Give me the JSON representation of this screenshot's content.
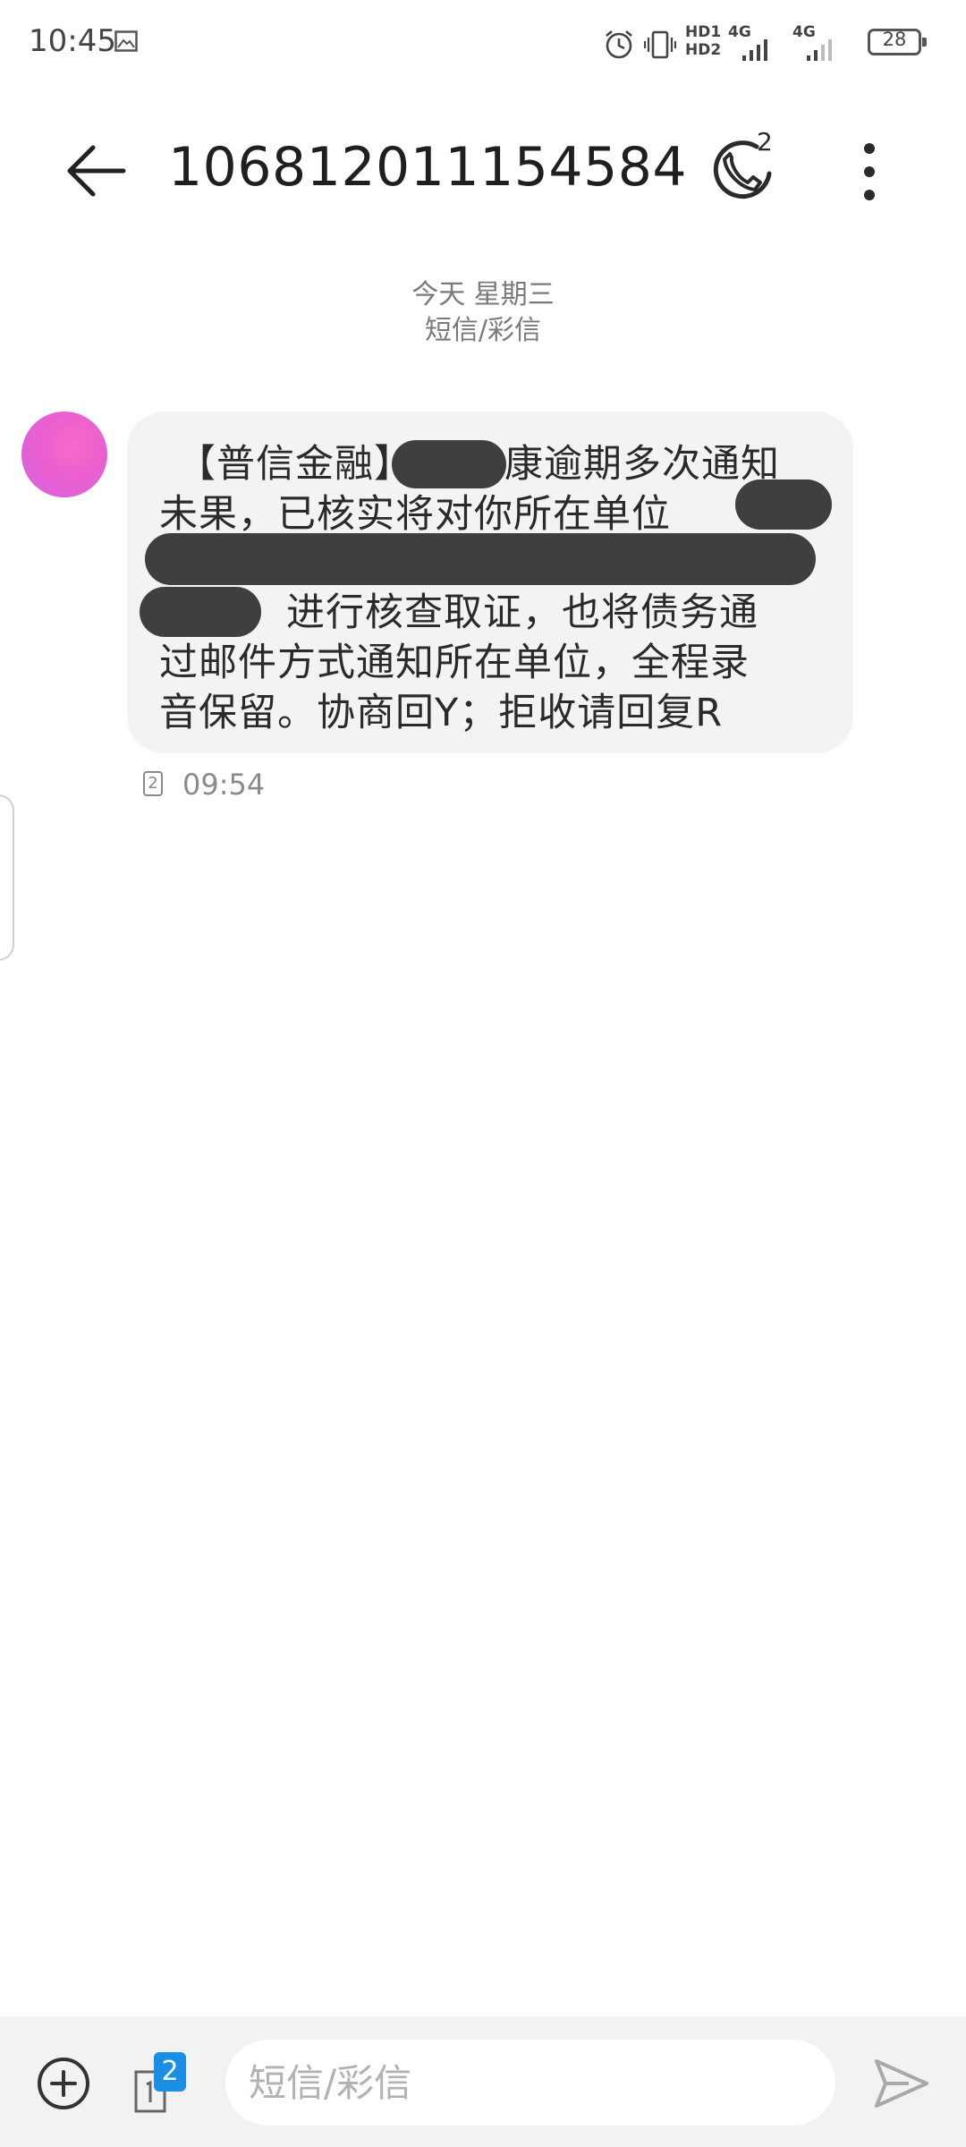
{
  "status_bar": {
    "time": "10:45",
    "hd1": "HD1",
    "hd2": "HD2",
    "net1": "4G",
    "net2": "4G",
    "battery": "28"
  },
  "header": {
    "title": "106812011154584",
    "call_count": "2"
  },
  "date_separator": {
    "day": "今天 星期三",
    "type": "短信/彩信"
  },
  "message": {
    "lines": [
      "【普信金融】",
      "康逾期多次通知",
      "未果，已核实将对你所在单位",
      "进行核查取证，也将债务通",
      "过邮件方式通知所在单位，全程录",
      "音保留。协商回Y；拒收请回复R"
    ],
    "sim": "2",
    "time": "09:54"
  },
  "composer": {
    "placeholder": "短信/彩信",
    "sim_badge": "2"
  },
  "colors": {
    "bubble": "#f3f3f3",
    "accent": "#1a8fe6",
    "redaction": "#3f3f3f"
  }
}
